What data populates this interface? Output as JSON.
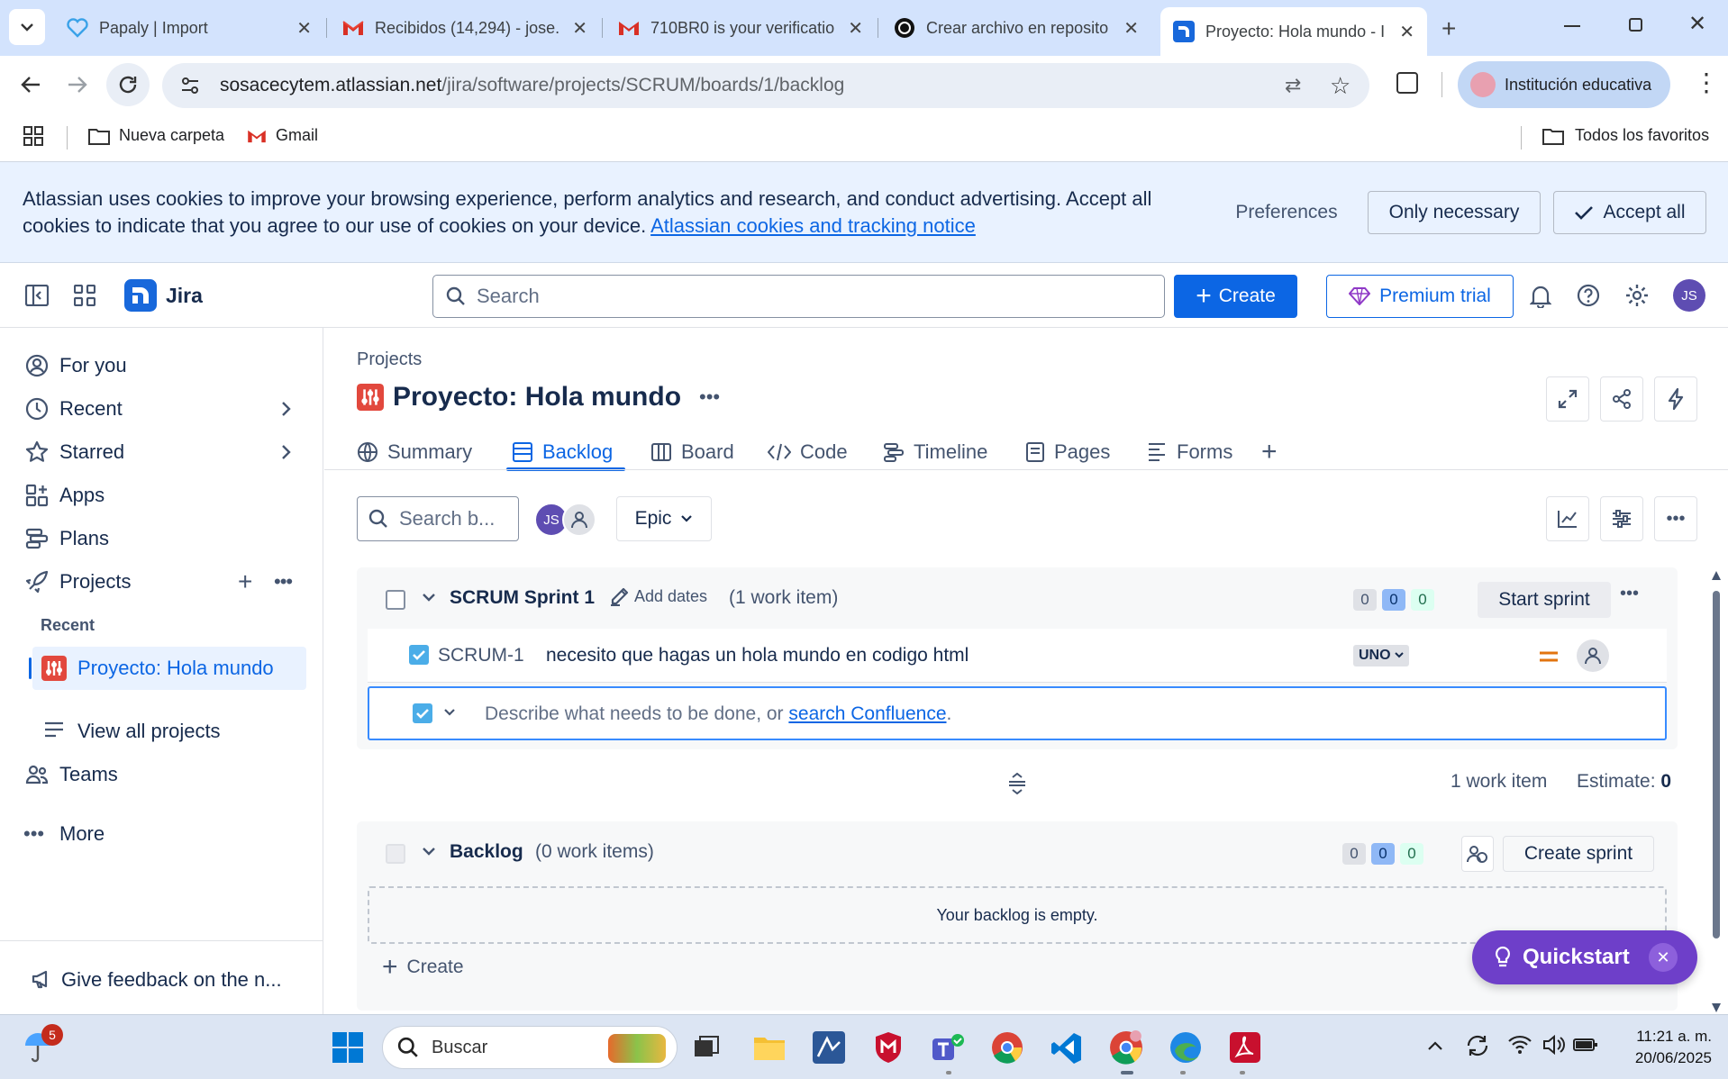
{
  "browser": {
    "tabs": [
      {
        "title": "Papaly | Import",
        "icon": "heart-icon"
      },
      {
        "title": "Recibidos (14,294) - jose.",
        "icon": "gmail-icon"
      },
      {
        "title": "710BR0 is your verificatio",
        "icon": "gmail-icon"
      },
      {
        "title": "Crear archivo en reposito",
        "icon": "openai-icon"
      },
      {
        "title": "Proyecto: Hola mundo - I",
        "icon": "jira-icon"
      }
    ],
    "url_host": "sosacecytem.atlassian.net",
    "url_path": "/jira/software/projects/SCRUM/boards/1/backlog",
    "profile_label": "Institución educativa",
    "bookmarks": [
      {
        "label": "Nueva carpeta",
        "icon": "folder-icon"
      },
      {
        "label": "Gmail",
        "icon": "gmail-icon"
      }
    ],
    "all_bookmarks": "Todos los favoritos"
  },
  "cookie": {
    "text": "Atlassian uses cookies to improve your browsing experience, perform analytics and research, and conduct advertising. Accept all cookies to indicate that you agree to our use of cookies on your device.",
    "link": "Atlassian cookies and tracking notice",
    "preferences": "Preferences",
    "only_necessary": "Only necessary",
    "accept_all": "Accept all"
  },
  "header": {
    "app_name": "Jira",
    "search_placeholder": "Search",
    "create": "Create",
    "premium": "Premium trial",
    "avatar": "JS"
  },
  "sidebar": {
    "items": [
      {
        "label": "For you",
        "icon": "person-icon"
      },
      {
        "label": "Recent",
        "icon": "clock-icon"
      },
      {
        "label": "Starred",
        "icon": "star-icon"
      },
      {
        "label": "Apps",
        "icon": "apps-icon"
      },
      {
        "label": "Plans",
        "icon": "plans-icon"
      },
      {
        "label": "Projects",
        "icon": "rocket-icon"
      }
    ],
    "recent_heading": "Recent",
    "current_project": "Proyecto: Hola mundo",
    "view_all": "View all projects",
    "teams": "Teams",
    "more": "More",
    "feedback": "Give feedback on the n..."
  },
  "project": {
    "breadcrumb": "Projects",
    "title": "Proyecto: Hola mundo",
    "tabs": [
      {
        "label": "Summary",
        "icon": "globe-icon"
      },
      {
        "label": "Backlog",
        "icon": "backlog-icon",
        "active": true
      },
      {
        "label": "Board",
        "icon": "board-icon"
      },
      {
        "label": "Code",
        "icon": "code-icon"
      },
      {
        "label": "Timeline",
        "icon": "timeline-icon"
      },
      {
        "label": "Pages",
        "icon": "pages-icon"
      },
      {
        "label": "Forms",
        "icon": "forms-icon"
      }
    ]
  },
  "toolbar": {
    "search_placeholder": "Search b...",
    "avatar": "JS",
    "epic": "Epic"
  },
  "sprint": {
    "name": "SCRUM Sprint 1",
    "add_dates": "Add dates",
    "count": "(1 work item)",
    "counters": [
      "0",
      "0",
      "0"
    ],
    "start": "Start sprint",
    "item": {
      "key": "SCRUM-1",
      "summary": "necesito que hagas un hola mundo en codigo html",
      "epic": "UNO"
    },
    "input_placeholder": "Describe what needs to be done, or",
    "input_link": "search Confluence",
    "footer_items": "1 work item",
    "footer_estimate": "Estimate:",
    "footer_estimate_value": "0"
  },
  "backlog": {
    "name": "Backlog",
    "count": "(0 work items)",
    "counters": [
      "0",
      "0",
      "0"
    ],
    "create_sprint": "Create sprint",
    "empty": "Your backlog is empty.",
    "create": "Create"
  },
  "quickstart": {
    "label": "Quickstart"
  },
  "taskbar": {
    "search": "Buscar",
    "time": "11:21 a. m.",
    "date": "20/06/2025",
    "weather_badge": "5"
  },
  "colors": {
    "brand": "#0c66e4",
    "quickstart": "#6e3fc9",
    "avatar": "#5e4db2"
  }
}
